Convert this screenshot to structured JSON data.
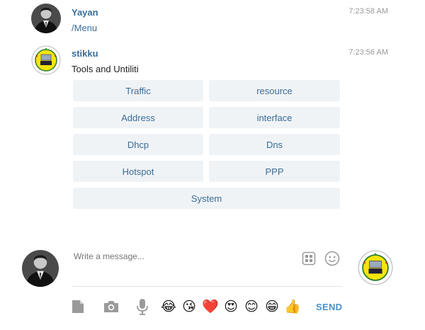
{
  "messages": [
    {
      "sender": "Yayan",
      "time": "7:23:58 AM",
      "text": "/Menu",
      "avatar": "user-photo"
    },
    {
      "sender": "stikku",
      "time": "7:23:56 AM",
      "text": "Tools and Untiliti",
      "avatar": "bot-logo"
    }
  ],
  "keyboard": {
    "buttons": [
      "Traffic",
      "resource",
      "Address",
      "interface",
      "Dhcp",
      "Dns",
      "Hotspot",
      "PPP",
      "System"
    ]
  },
  "composer": {
    "placeholder": "Write a message...",
    "send_label": "SEND",
    "emojis": [
      "😂",
      "😘",
      "❤️",
      "😍",
      "😊",
      "😁",
      "👍"
    ]
  },
  "colors": {
    "accent": "#3a6d99",
    "button_bg": "#f0f3f6",
    "send": "#4a90c8",
    "logo_yellow": "#f5e50a"
  }
}
